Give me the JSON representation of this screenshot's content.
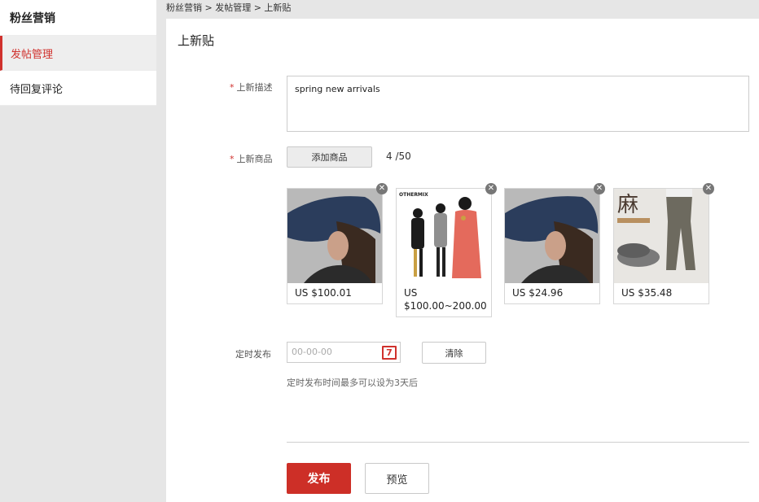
{
  "sidebar": {
    "header": "粉丝营销",
    "items": [
      {
        "label": "发帖管理",
        "active": true
      },
      {
        "label": "待回复评论",
        "active": false
      }
    ]
  },
  "breadcrumb": "粉丝营销 > 发帖管理 > 上新贴",
  "page": {
    "title": "上新贴"
  },
  "form": {
    "desc_label": "上新描述",
    "desc_value": "spring new arrivals",
    "products_label": "上新商品",
    "add_button": "添加商品",
    "count": "4",
    "count_max": "/50",
    "schedule_label": "定时发布",
    "date_placeholder": "00-00-00",
    "calendar_icon_text": "7",
    "clear_button": "清除",
    "schedule_hint": "定时发布时间最多可以设为3天后",
    "publish_button": "发布",
    "preview_button": "预览"
  },
  "products": [
    {
      "price": "US $100.01",
      "image": "hat-woman"
    },
    {
      "price": "US $100.00~200.00",
      "image": "dresses-group",
      "brand": "OTHERMIX"
    },
    {
      "price": "US $24.96",
      "image": "hat-woman"
    },
    {
      "price": "US $35.48",
      "image": "linen-pants",
      "overlay": "麻"
    }
  ],
  "colors": {
    "accent": "#d0312d",
    "publish": "#cd2f27"
  }
}
